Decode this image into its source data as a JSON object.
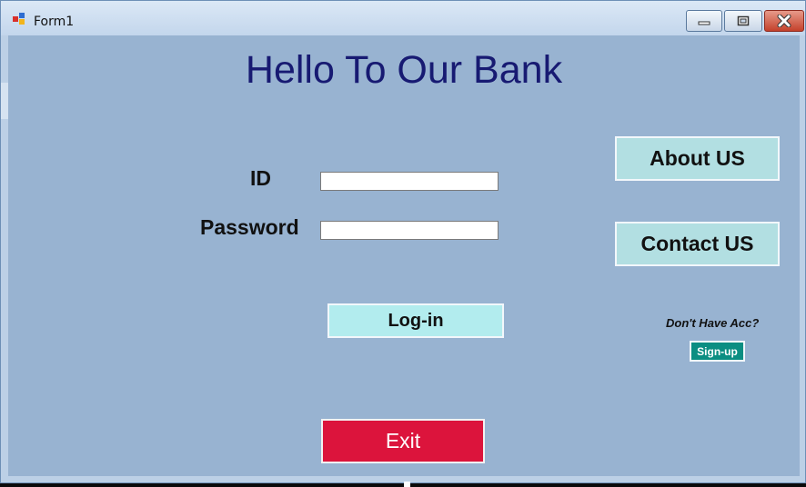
{
  "window": {
    "title": "Form1",
    "icon": "winforms-app-icon",
    "controls": {
      "minimize": "minimize-icon",
      "maximize": "maximize-icon",
      "close": "close-icon"
    }
  },
  "form": {
    "heading": "Hello To Our Bank",
    "id_label": "ID",
    "id_value": "",
    "password_label": "Password",
    "password_value": "",
    "login_button": "Log-in",
    "about_button": "About US",
    "contact_button": "Contact US",
    "no_account_text": "Don't Have Acc?",
    "signup_button": "Sign-up",
    "exit_button": "Exit"
  },
  "colors": {
    "form_background": "#98b3d1",
    "heading": "#171a72",
    "side_buttons": "#b2dfe2",
    "login_button": "#b2ecee",
    "exit_button": "#dc143c",
    "signup_button": "#0b8e82"
  }
}
